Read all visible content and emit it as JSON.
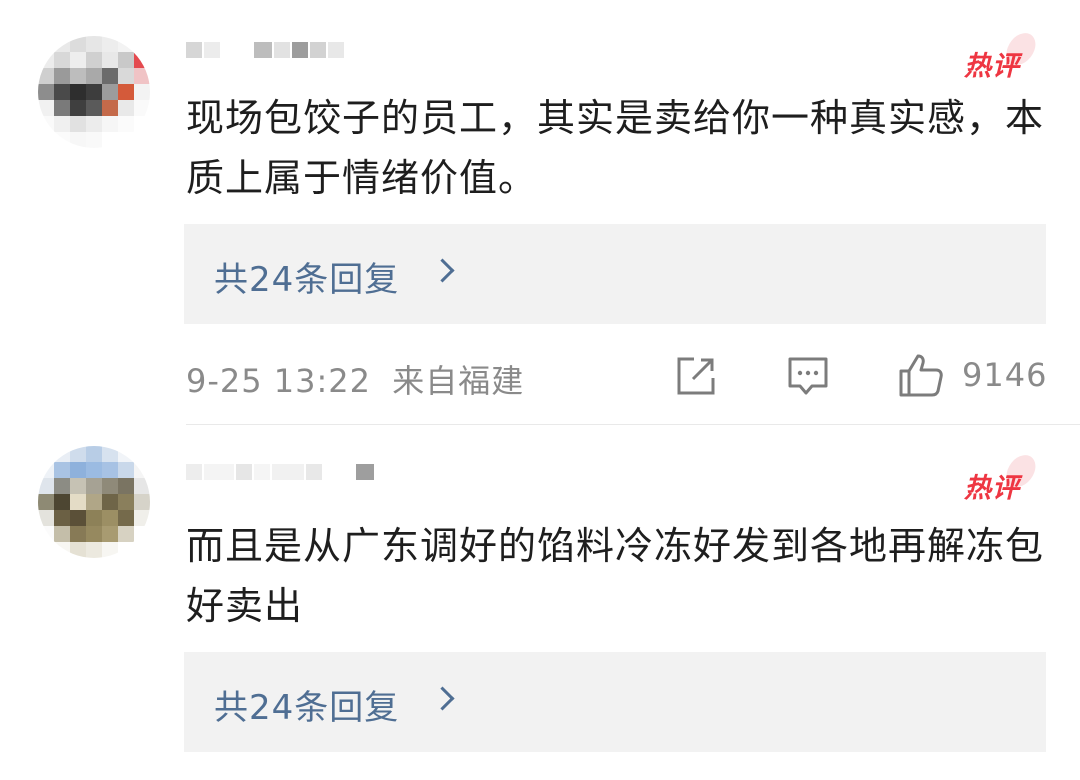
{
  "comments": [
    {
      "badge": "热评",
      "text": "现场包饺子的员工，其实是卖给你一种真实感，本质上属于情绪价值。",
      "replies_label": "共24条回复",
      "timestamp": "9-25 13:22",
      "location": "来自福建",
      "likes": "9146",
      "icons": [
        "share-icon",
        "comment-icon",
        "like-icon",
        "chevron-right-icon"
      ]
    },
    {
      "badge": "热评",
      "text": "而且是从广东调好的馅料冷冻好发到各地再解冻包好卖出",
      "replies_label": "共24条回复",
      "icons": [
        "chevron-right-icon"
      ]
    }
  ],
  "colors": {
    "text": "#1e1e1e",
    "meta": "#8a8a8a",
    "link": "#4f6e93",
    "hot": "#ee3642",
    "reply_bg": "#f2f2f2"
  }
}
